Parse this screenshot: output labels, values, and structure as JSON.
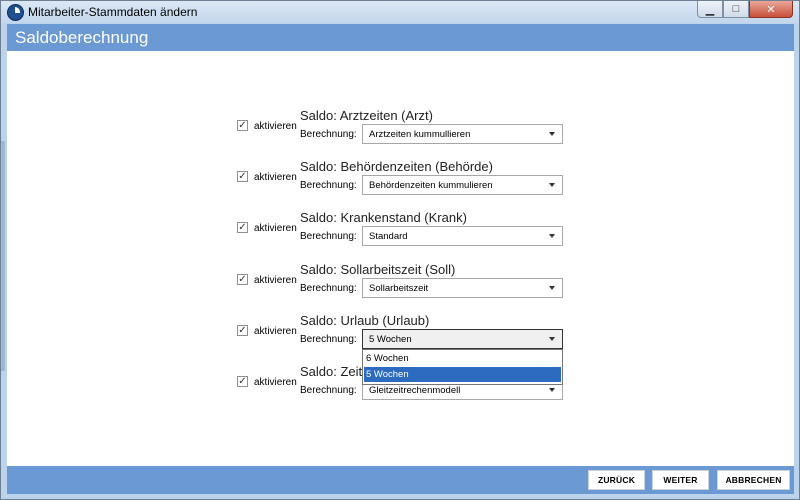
{
  "window": {
    "title": "Mitarbeiter-Stammdaten ändern"
  },
  "header": {
    "title": "Saldoberechnung"
  },
  "groups": [
    {
      "checked": true,
      "activate_label": "aktivieren",
      "title": "Saldo: Arztzeiten (Arzt)",
      "calc_label": "Berechnung:",
      "value": "Arztzeiten kummullieren"
    },
    {
      "checked": true,
      "activate_label": "aktivieren",
      "title": "Saldo: Behördenzeiten (Behörde)",
      "calc_label": "Berechnung:",
      "value": "Behördenzeiten kummulieren"
    },
    {
      "checked": true,
      "activate_label": "aktivieren",
      "title": "Saldo: Krankenstand (Krank)",
      "calc_label": "Berechnung:",
      "value": "Standard"
    },
    {
      "checked": true,
      "activate_label": "aktivieren",
      "title": "Saldo: Sollarbeitszeit (Soll)",
      "calc_label": "Berechnung:",
      "value": "Sollarbeitszeit"
    },
    {
      "checked": true,
      "activate_label": "aktivieren",
      "title": "Saldo: Urlaub (Urlaub)",
      "calc_label": "Berechnung:",
      "value": "5 Wochen"
    },
    {
      "checked": true,
      "activate_label": "aktivieren",
      "title": "Saldo: Zeit",
      "calc_label": "Berechnung:",
      "value": "Gleitzeitrechenmodell"
    }
  ],
  "dropdown": {
    "options": [
      "6 Wochen",
      "5 Wochen"
    ],
    "selected_index": 1
  },
  "footer": {
    "back_label": "ZURÜCK",
    "next_label": "WEITER",
    "cancel_label": "ABBRECHEN"
  },
  "icons": {
    "app": "app-logo-icon",
    "minimize": "minimize-icon",
    "maximize": "maximize-icon",
    "close": "close-icon",
    "checkbox": "checkmark-icon",
    "dropdown": "chevron-down-icon"
  },
  "colors": {
    "header": "#6a99d3",
    "footer": "#6a99d3",
    "selection": "#2d6bc1"
  }
}
